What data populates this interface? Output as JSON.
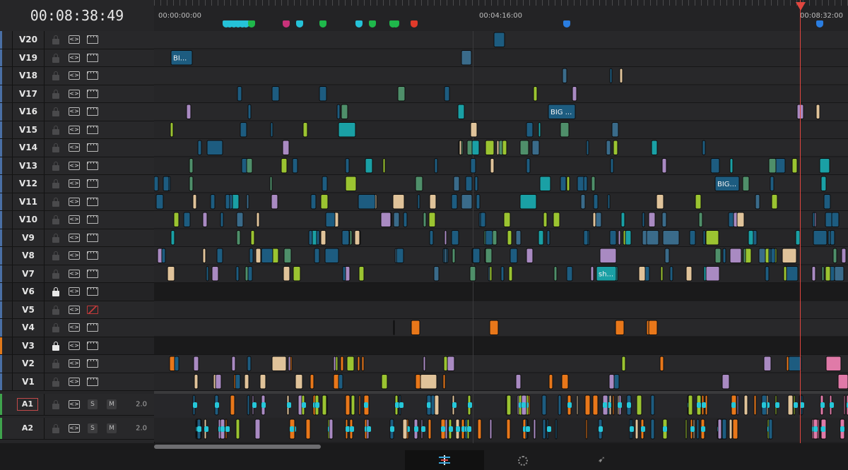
{
  "timecode": "00:08:38:49",
  "ruler": {
    "labels": [
      {
        "text": "00:00:00:00",
        "pos": 0
      },
      {
        "text": "00:04:16:00",
        "pos": 0.5
      },
      {
        "text": "00:08:32:00",
        "pos": 1.0
      }
    ],
    "markers": [
      {
        "t": 0.055,
        "color": "#25c2d8"
      },
      {
        "t": 0.062,
        "color": "#25c2d8"
      },
      {
        "t": 0.069,
        "color": "#25c2d8"
      },
      {
        "t": 0.076,
        "color": "#25c2d8"
      },
      {
        "t": 0.083,
        "color": "#25c2d8"
      },
      {
        "t": 0.09,
        "color": "#25c2d8"
      },
      {
        "t": 0.1,
        "color": "#1fb84b"
      },
      {
        "t": 0.16,
        "color": "#c8327a"
      },
      {
        "t": 0.183,
        "color": "#25c2d8"
      },
      {
        "t": 0.224,
        "color": "#1fb84b"
      },
      {
        "t": 0.286,
        "color": "#25c2d8"
      },
      {
        "t": 0.31,
        "color": "#1fb84b"
      },
      {
        "t": 0.345,
        "color": "#1fb84b"
      },
      {
        "t": 0.35,
        "color": "#1fb84b"
      },
      {
        "t": 0.382,
        "color": "#e03a2a"
      },
      {
        "t": 0.647,
        "color": "#2a7de0"
      },
      {
        "t": 1.087,
        "color": "#2a7de0"
      }
    ]
  },
  "video_tracks": [
    {
      "name": "V20",
      "locked": false,
      "enabled": true
    },
    {
      "name": "V19",
      "locked": false,
      "enabled": true
    },
    {
      "name": "V18",
      "locked": false,
      "enabled": true
    },
    {
      "name": "V17",
      "locked": false,
      "enabled": true
    },
    {
      "name": "V16",
      "locked": false,
      "enabled": true
    },
    {
      "name": "V15",
      "locked": false,
      "enabled": true
    },
    {
      "name": "V14",
      "locked": false,
      "enabled": true
    },
    {
      "name": "V13",
      "locked": false,
      "enabled": true
    },
    {
      "name": "V12",
      "locked": false,
      "enabled": true
    },
    {
      "name": "V11",
      "locked": false,
      "enabled": true
    },
    {
      "name": "V10",
      "locked": false,
      "enabled": true
    },
    {
      "name": "V9",
      "locked": false,
      "enabled": true
    },
    {
      "name": "V8",
      "locked": false,
      "enabled": true
    },
    {
      "name": "V7",
      "locked": false,
      "enabled": true
    },
    {
      "name": "V6",
      "locked": true,
      "enabled": true
    },
    {
      "name": "V5",
      "locked": false,
      "enabled": false
    },
    {
      "name": "V4",
      "locked": false,
      "enabled": true
    },
    {
      "name": "V3",
      "locked": true,
      "enabled": true
    },
    {
      "name": "V2",
      "locked": false,
      "enabled": true
    },
    {
      "name": "V1",
      "locked": false,
      "enabled": true
    }
  ],
  "audio_tracks": [
    {
      "name": "A1",
      "selected": true,
      "solo": "S",
      "mute": "M",
      "volume": "2.0"
    },
    {
      "name": "A2",
      "selected": false,
      "solo": "S",
      "mute": "M",
      "volume": "2.0"
    }
  ],
  "clip_titles": [
    {
      "track": 1,
      "text": "BI..."
    },
    {
      "track": 4,
      "text": "BIG ..."
    },
    {
      "track": 8,
      "text": "BIG..."
    },
    {
      "track": 13,
      "text": "sh..."
    }
  ],
  "colors": {
    "playhead": "#e0463f",
    "clip_blue": "#1d5c80",
    "clip_teal": "#1aa0a5",
    "clip_orange": "#e8771a",
    "clip_lime": "#9bc431",
    "clip_beige": "#e0c39a",
    "clip_lavender": "#a98ac2",
    "clip_pink": "#e07aa8",
    "clip_cyan": "#25c7d9"
  },
  "icons": {
    "lock": "lock-icon",
    "auto_track": "auto-select-icon",
    "video_enable": "film-strip-icon",
    "page_edit": "edit-page-icon",
    "page_fusion": "fusion-page-icon",
    "page_deliver": "deliver-rocket-icon"
  }
}
